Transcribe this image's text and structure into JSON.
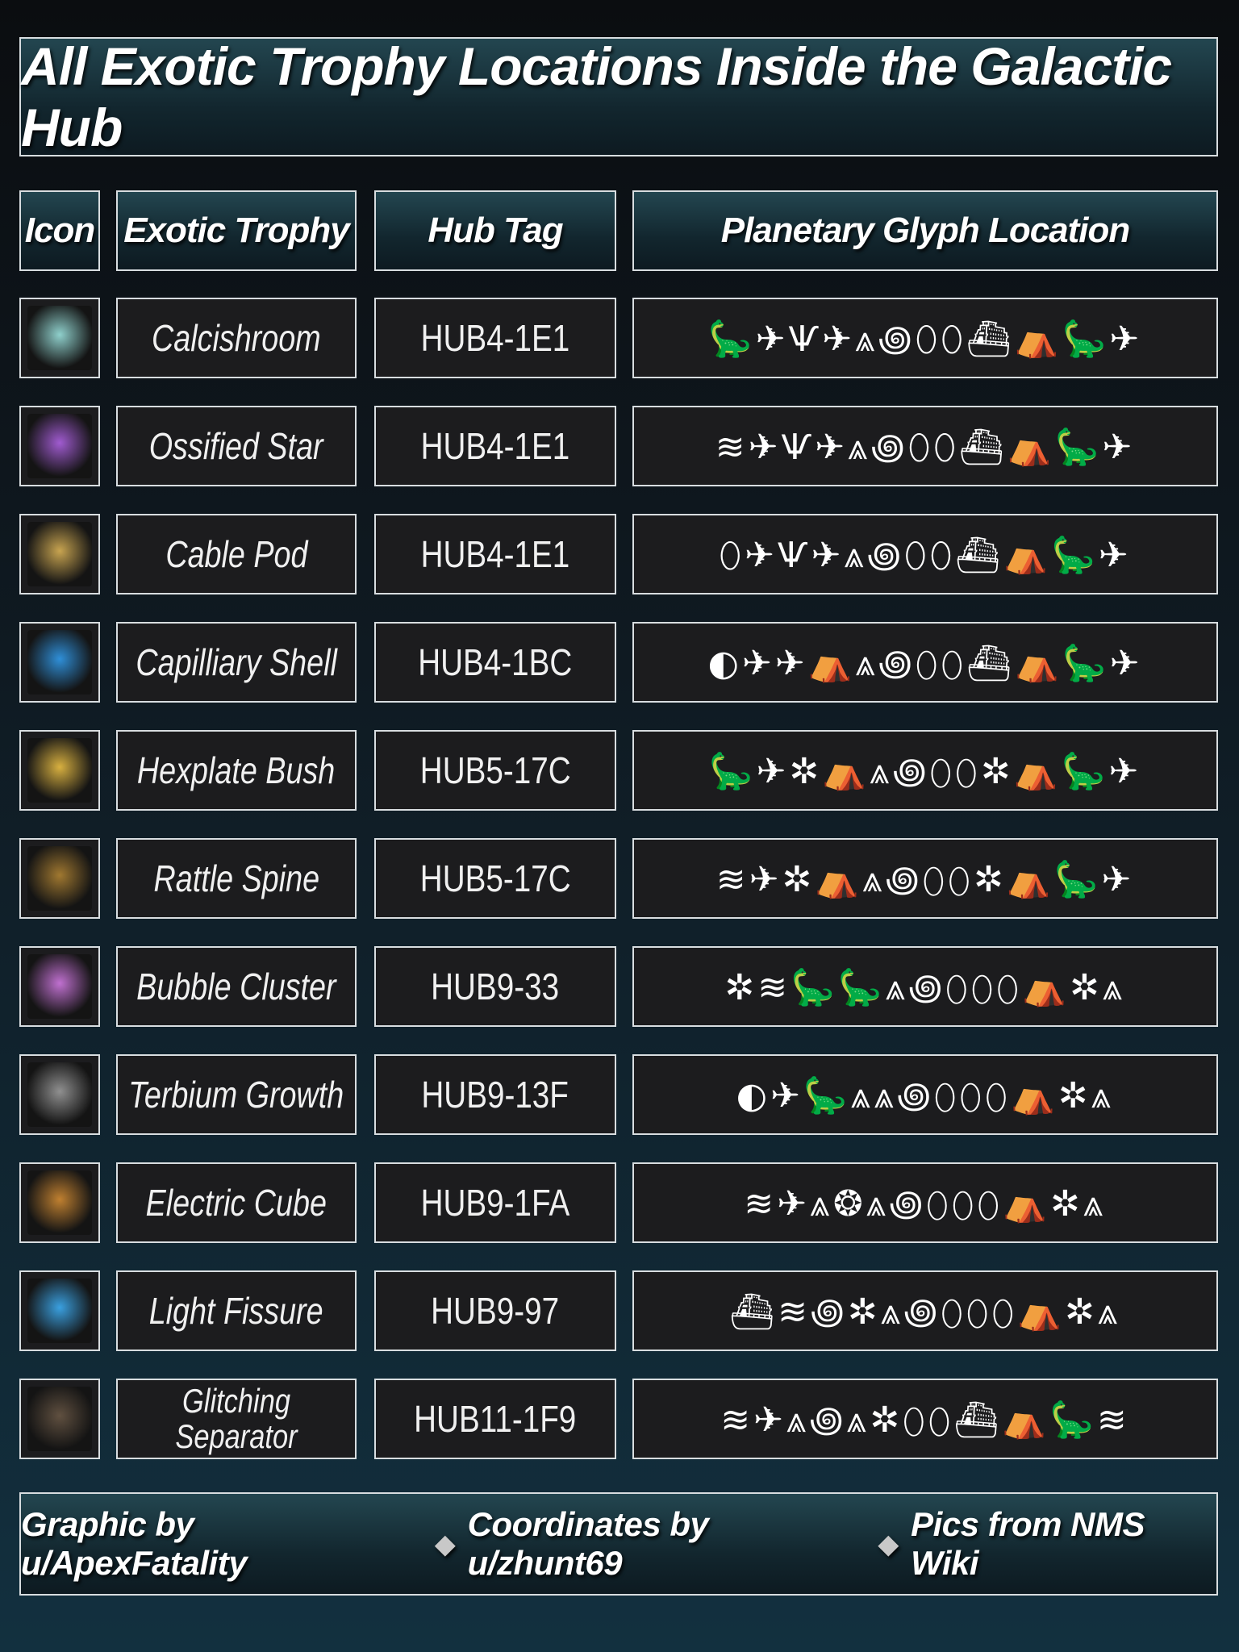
{
  "title": "All Exotic Trophy Locations Inside the Galactic Hub",
  "headers": {
    "icon": "Icon",
    "trophy": "Exotic Trophy",
    "tag": "Hub Tag",
    "glyph": "Planetary Glyph Location"
  },
  "rows": [
    {
      "name": "Calcishroom",
      "tag": "HUB4-1E1",
      "glyphs": "🦕✈Ѱ✈⩓꩜⬯⬯⛴⛺🦕✈",
      "icon_color": "#8fd0cc"
    },
    {
      "name": "Ossified Star",
      "tag": "HUB4-1E1",
      "glyphs": "≋✈Ѱ✈⩓꩜⬯⬯⛴⛺🦕✈",
      "icon_color": "#a05bd0"
    },
    {
      "name": "Cable Pod",
      "tag": "HUB4-1E1",
      "glyphs": "⬯✈Ѱ✈⩓꩜⬯⬯⛴⛺🦕✈",
      "icon_color": "#c8a450"
    },
    {
      "name": "Capilliary Shell",
      "tag": "HUB4-1BC",
      "glyphs": "◐✈✈⛺⩓꩜⬯⬯⛴⛺🦕✈",
      "icon_color": "#2f8fd8"
    },
    {
      "name": "Hexplate Bush",
      "tag": "HUB5-17C",
      "glyphs": "🦕✈✲⛺⩓꩜⬯⬯✲⛺🦕✈",
      "icon_color": "#d8b040"
    },
    {
      "name": "Rattle Spine",
      "tag": "HUB5-17C",
      "glyphs": "≋✈✲⛺⩓꩜⬯⬯✲⛺🦕✈",
      "icon_color": "#a07830"
    },
    {
      "name": "Bubble Cluster",
      "tag": "HUB9-33",
      "glyphs": "✲≋🦕🦕⩓꩜⬯⬯⬯⛺✲⩓",
      "icon_color": "#c070d0"
    },
    {
      "name": "Terbium Growth",
      "tag": "HUB9-13F",
      "glyphs": "◐✈🦕⩓⩓꩜⬯⬯⬯⛺✲⩓",
      "icon_color": "#909090"
    },
    {
      "name": "Electric Cube",
      "tag": "HUB9-1FA",
      "glyphs": "≋✈⩓❂⩓꩜⬯⬯⬯⛺✲⩓",
      "icon_color": "#c08030"
    },
    {
      "name": "Light Fissure",
      "tag": "HUB9-97",
      "glyphs": "⛴≋꩜✲⩓꩜⬯⬯⬯⛺✲⩓",
      "icon_color": "#3aa0e0"
    },
    {
      "name": "Glitching Separator",
      "tag": "HUB11-1F9",
      "glyphs": "≋✈⩓꩜⩓✲⬯⬯⛴⛺🦕≋",
      "icon_color": "#605040"
    }
  ],
  "footer": {
    "graphic": "Graphic by u/ApexFatality",
    "coords": "Coordinates by u/zhunt69",
    "pics": "Pics from NMS Wiki",
    "separator": "◆"
  }
}
